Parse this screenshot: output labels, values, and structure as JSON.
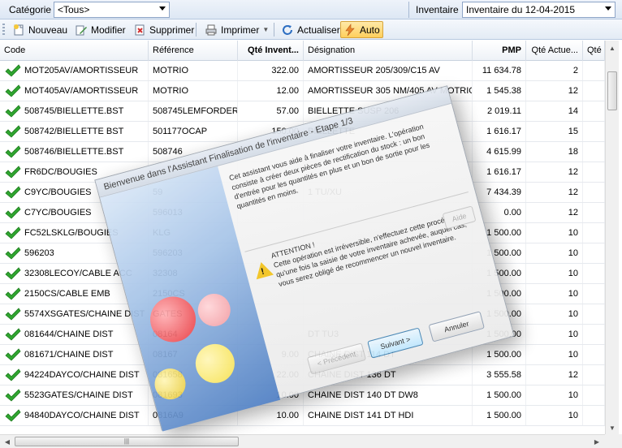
{
  "topbar": {
    "category_label": "Catégorie",
    "category_value": "<Tous>",
    "inventory_label": "Inventaire",
    "inventory_value": "Inventaire du 12-04-2015"
  },
  "toolbar": {
    "new_label": "Nouveau",
    "edit_label": "Modifier",
    "delete_label": "Supprimer",
    "print_label": "Imprimer",
    "refresh_label": "Actualiser",
    "auto_label": "Auto"
  },
  "grid": {
    "columns": [
      "Code",
      "Référence",
      "Qté Invent...",
      "Désignation",
      "PMP",
      "Qté Actue...",
      "Qté"
    ],
    "rows": [
      {
        "code": "MOT205AV/AMORTISSEUR",
        "ref": "MOTRIO",
        "qty": "322.00",
        "designation": "AMORTISSEUR 205/309/C15 AV",
        "pmp": "11 634.78",
        "actual": "2"
      },
      {
        "code": "MOT405AV/AMORTISSEUR",
        "ref": "MOTRIO",
        "qty": "12.00",
        "designation": "AMORTISSEUR 305 NM/405 AV MOTRIO",
        "pmp": "1 545.38",
        "actual": "12"
      },
      {
        "code": "508745/BIELLETTE.BST",
        "ref": "508745LEMFORDER",
        "qty": "57.00",
        "designation": "BIELLETTE SUSP 206",
        "pmp": "2 019.11",
        "actual": "14"
      },
      {
        "code": "508742/BIELLETTE BST",
        "ref": "501177OCAP",
        "qty": "150.00",
        "designation": "BIELLETTE",
        "pmp": "1 616.17",
        "actual": "15"
      },
      {
        "code": "508746/BIELLETTE.BST",
        "ref": "508746",
        "qty": "",
        "designation": "",
        "pmp": "4 615.99",
        "actual": "18"
      },
      {
        "code": "FR6DC/BOUGIES",
        "ref": "",
        "qty": "",
        "designation": "",
        "pmp": "1 616.17",
        "actual": "12"
      },
      {
        "code": "C9YC/BOUGIES",
        "ref": "59",
        "qty": "",
        "designation": "1 TU/XU",
        "pmp": "7 434.39",
        "actual": "12"
      },
      {
        "code": "C7YC/BOUGIES",
        "ref": "596013",
        "qty": "",
        "designation": "",
        "pmp": "0.00",
        "actual": "12"
      },
      {
        "code": "FC52LSKLG/BOUGIES",
        "ref": "KLG",
        "qty": "",
        "designation": "",
        "pmp": "1 500.00",
        "actual": "10"
      },
      {
        "code": "596203",
        "ref": "596203",
        "qty": "",
        "designation": "",
        "pmp": "1 500.00",
        "actual": "10"
      },
      {
        "code": "32308LECOY/CABLE ACC",
        "ref": "32308",
        "qty": "",
        "designation": "",
        "pmp": "1 500.00",
        "actual": "10"
      },
      {
        "code": "2150CS/CABLE EMB",
        "ref": "2150CS",
        "qty": "",
        "designation": "",
        "pmp": "1 500.00",
        "actual": "10"
      },
      {
        "code": "5574XSGATES/CHAINE DIST",
        "ref": "GATES",
        "qty": "",
        "designation": "",
        "pmp": "1 500.00",
        "actual": "10"
      },
      {
        "code": "081644/CHAINE DIST",
        "ref": "08164",
        "qty": "",
        "designation": "DT TU3",
        "pmp": "1 500.00",
        "actual": "10"
      },
      {
        "code": "081671/CHAINE DIST",
        "ref": "08167",
        "qty": "9.00",
        "designation": "CHAINE DIST 114 DT",
        "pmp": "1 500.00",
        "actual": "10"
      },
      {
        "code": "94224DAYCO/CHAINE DIST",
        "ref": "081658",
        "qty": "22.00",
        "designation": "CHAINE DIST 136 DT",
        "pmp": "3 555.58",
        "actual": "12"
      },
      {
        "code": "5523GATES/CHAINE DIST",
        "ref": "081693",
        "qty": "10.00",
        "designation": "CHAINE DIST 140 DT DW8",
        "pmp": "1 500.00",
        "actual": "10"
      },
      {
        "code": "94840DAYCO/CHAINE DIST",
        "ref": "0816A9",
        "qty": "10.00",
        "designation": "CHAINE DIST 141 DT HDI",
        "pmp": "1 500.00",
        "actual": "10"
      }
    ]
  },
  "wizard": {
    "title": "Bienvenue dans l'Assistant Finalisation de l'inventaire - Etape 1/3",
    "intro": "Cet assistant vous aide à finaliser votre inventaire. L'opération consiste à créer deux pièces de rectification du stock : un bon d'entrée pour les quantités en plus et un bon de sortie pour les quantités en moins.",
    "attention_title": "ATTENTION !",
    "attention_text": "Cette opération est irréversible, n'effectuez cette procédure qu'une fois la saisie de votre inventaire achevée, auquel cas, vous serez obligé de recommencer un nouvel inventaire.",
    "help_button": "Aide",
    "prev_button": "< Précédent",
    "next_button": "Suivant >",
    "cancel_button": "Annuler",
    "colors": {
      "bubble_red": "#e8343a",
      "bubble_yellow": "#f6e04a",
      "bubble_pink": "#f29aa0"
    }
  }
}
